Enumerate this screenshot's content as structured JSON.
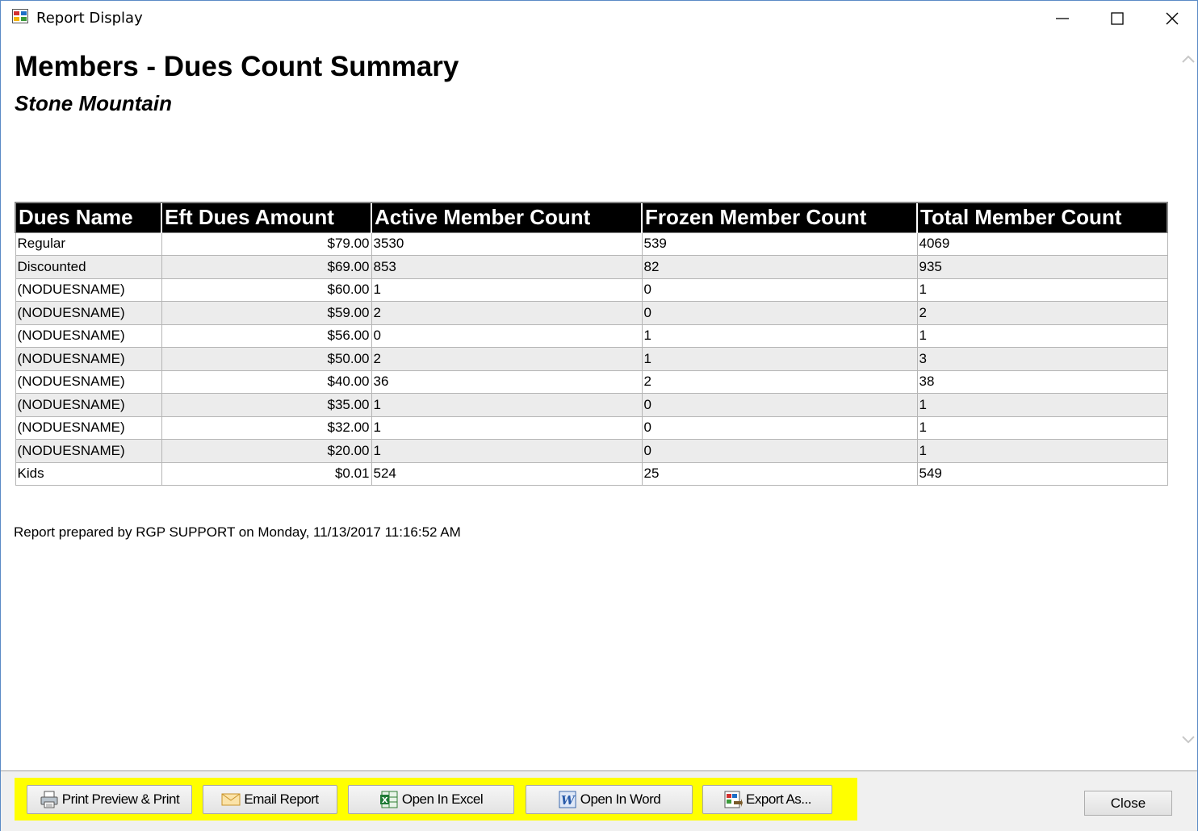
{
  "window": {
    "title": "Report Display"
  },
  "report": {
    "title": "Members - Dues Count Summary",
    "subtitle": "Stone Mountain",
    "columns": [
      "Dues Name",
      "Eft Dues Amount",
      "Active Member Count",
      "Frozen Member Count",
      "Total Member Count"
    ],
    "rows": [
      [
        "Regular",
        "$79.00",
        "3530",
        "539",
        "4069"
      ],
      [
        "Discounted",
        "$69.00",
        "853",
        "82",
        "935"
      ],
      [
        "(NODUESNAME)",
        "$60.00",
        "1",
        "0",
        "1"
      ],
      [
        "(NODUESNAME)",
        "$59.00",
        "2",
        "0",
        "2"
      ],
      [
        "(NODUESNAME)",
        "$56.00",
        "0",
        "1",
        "1"
      ],
      [
        "(NODUESNAME)",
        "$50.00",
        "2",
        "1",
        "3"
      ],
      [
        "(NODUESNAME)",
        "$40.00",
        "36",
        "2",
        "38"
      ],
      [
        "(NODUESNAME)",
        "$35.00",
        "1",
        "0",
        "1"
      ],
      [
        "(NODUESNAME)",
        "$32.00",
        "1",
        "0",
        "1"
      ],
      [
        "(NODUESNAME)",
        "$20.00",
        "1",
        "0",
        "1"
      ],
      [
        "Kids",
        "$0.01",
        "524",
        "25",
        "549"
      ]
    ],
    "prepared_by": "Report prepared by RGP SUPPORT on Monday, 11/13/2017 11:16:52 AM"
  },
  "toolbar": {
    "print_label": "Print Preview & Print",
    "email_label": "Email Report",
    "excel_label": "Open In Excel",
    "word_label": "Open In Word",
    "export_label": "Export As...",
    "close_label": "Close",
    "highlight_color": "#ffff00"
  },
  "icons": {
    "app": "report-app-icon",
    "print": "printer-icon",
    "email": "envelope-icon",
    "excel": "excel-icon",
    "word": "word-icon",
    "export": "export-icon"
  }
}
